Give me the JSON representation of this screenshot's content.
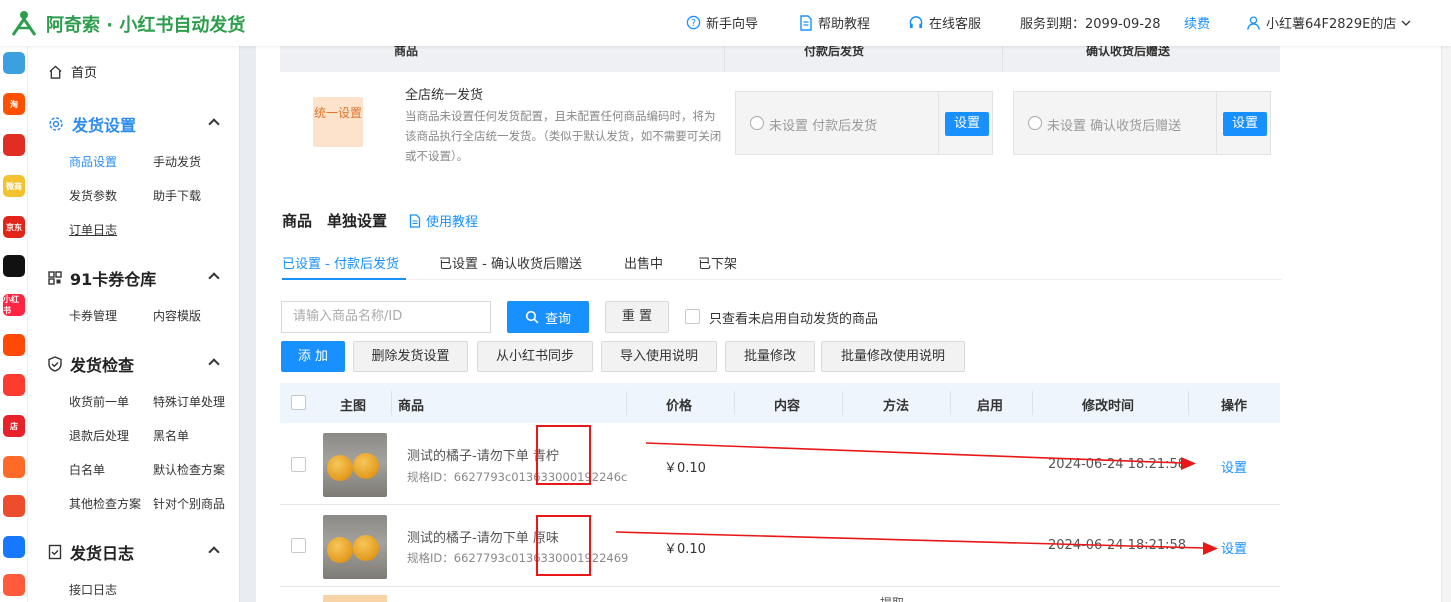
{
  "app": {
    "title": "阿奇索 · 小红书自动发货"
  },
  "topnav": {
    "guide": "新手向导",
    "help": "帮助教程",
    "service": "在线客服",
    "expiry": "服务到期：2099-09-28",
    "renew": "续费",
    "store": "小红薯64F2829E的店"
  },
  "rail_icons": [
    {
      "name": "qr-icon",
      "label": "",
      "color": "#3aa0e0"
    },
    {
      "name": "taobao-icon",
      "label": "淘",
      "color": "#ff5000"
    },
    {
      "name": "pinduoduo-icon",
      "label": "",
      "color": "#e02e24"
    },
    {
      "name": "weidian-icon",
      "label": "微商",
      "color": "#f2c230"
    },
    {
      "name": "jd-icon",
      "label": "京东",
      "color": "#e1251b"
    },
    {
      "name": "douyin-icon",
      "label": "",
      "color": "#111111"
    },
    {
      "name": "xiaohongshu-icon",
      "label": "小红书",
      "color": "#ff2442"
    },
    {
      "name": "kuaishou-icon",
      "label": "",
      "color": "#ff4906"
    },
    {
      "name": "thumb-icon",
      "label": "",
      "color": "#ff3b30"
    },
    {
      "name": "dian-icon",
      "label": "店",
      "color": "#e6212a"
    },
    {
      "name": "hand-icon",
      "label": "",
      "color": "#ff6a28"
    },
    {
      "name": "shopee-icon",
      "label": "",
      "color": "#ee4d2d"
    },
    {
      "name": "link-icon",
      "label": "",
      "color": "#1677ff"
    },
    {
      "name": "gift-icon",
      "label": "",
      "color": "#ff5a3c"
    }
  ],
  "sidebar": {
    "home": "首页",
    "groups": [
      {
        "title": "发货设置",
        "items": [
          "商品设置",
          "手动发货",
          "发货参数",
          "助手下载",
          "订单日志"
        ]
      },
      {
        "title": "91卡券仓库",
        "items": [
          "卡券管理",
          "内容模版"
        ]
      },
      {
        "title": "发货检查",
        "items": [
          "收货前一单",
          "特殊订单处理",
          "退款后处理",
          "黑名单",
          "白名单",
          "默认检查方案",
          "其他检查方案",
          "针对个别商品"
        ]
      },
      {
        "title": "发货日志",
        "items": [
          "接口日志"
        ]
      }
    ]
  },
  "global_header": {
    "product": "商品",
    "pay_after": "付款后发货",
    "confirm_after": "确认收货后赠送"
  },
  "unified": {
    "badge": "统一设置",
    "title": "全店统一发货",
    "desc": "当商品未设置任何发货配置，且未配置任何商品编码时，将为该商品执行全店统一发货。（类似于默认发货，如不需要可关闭或不设置）。",
    "option1": "未设置 付款后发货",
    "option2": "未设置 确认收货后赠送",
    "set_label": "设置"
  },
  "section": {
    "title": "商品　单独设置",
    "tutorial": "使用教程"
  },
  "tabs": [
    "已设置 - 付款后发货",
    "已设置 - 确认收货后赠送",
    "出售中",
    "已下架"
  ],
  "filter": {
    "placeholder": "请输入商品名称/ID",
    "query": "查询",
    "reset": "重 置",
    "only_disabled": "只查看未启用自动发货的商品"
  },
  "actions": [
    "添 加",
    "删除发货设置",
    "从小红书同步",
    "导入使用说明",
    "批量修改",
    "批量修改使用说明"
  ],
  "table": {
    "headers": [
      "主图",
      "商品",
      "价格",
      "内容",
      "方法",
      "启用",
      "修改时间",
      "操作"
    ],
    "rows": [
      {
        "name": "测试的橘子-请勿下单",
        "variant": "青柠",
        "spec_id": "规格ID：6627793c013633000192246c",
        "price": "￥0.10",
        "modified": "2024-06-24 18:21:58",
        "op": "设置"
      },
      {
        "name": "测试的橘子-请勿下单",
        "variant": "原味",
        "spec_id": "规格ID：6627793c0136330001922469",
        "price": "￥0.10",
        "modified": "2024-06-24 18:21:58",
        "op": "设置"
      }
    ],
    "partial_row_text": "提取"
  }
}
